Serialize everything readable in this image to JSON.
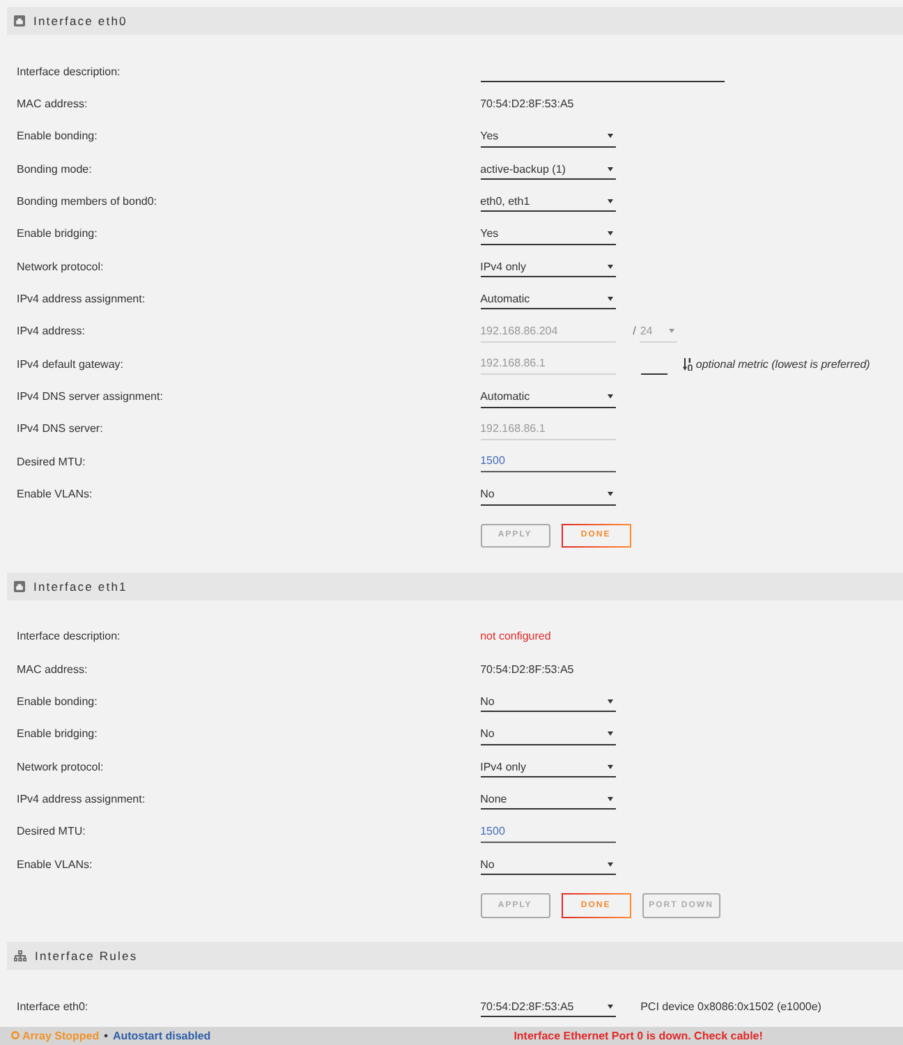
{
  "sections": [
    {
      "kind": "interface",
      "title": "Interface eth0",
      "rows": [
        {
          "label": "Interface description:",
          "controls": [
            {
              "kind": "widefield",
              "disabled": false
            }
          ]
        },
        {
          "label": "MAC address:",
          "controls": [
            {
              "kind": "text",
              "value": "70:54:D2:8F:53:A5",
              "alert": false
            }
          ]
        },
        {
          "label": "Enable bonding:",
          "controls": [
            {
              "kind": "select",
              "value": "Yes",
              "disabled": false
            }
          ]
        },
        {
          "label": "Bonding mode:",
          "controls": [
            {
              "kind": "select",
              "value": "active-backup (1)",
              "disabled": false
            }
          ]
        },
        {
          "label": "Bonding members of bond0:",
          "controls": [
            {
              "kind": "select",
              "value": "eth0, eth1",
              "disabled": false
            }
          ]
        },
        {
          "label": "Enable bridging:",
          "controls": [
            {
              "kind": "select",
              "value": "Yes",
              "disabled": false
            }
          ]
        },
        {
          "label": "Network protocol:",
          "controls": [
            {
              "kind": "select",
              "value": "IPv4 only",
              "disabled": false
            }
          ]
        },
        {
          "label": "IPv4 address assignment:",
          "controls": [
            {
              "kind": "select",
              "value": "Automatic",
              "disabled": false
            }
          ]
        },
        {
          "label": "IPv4 address:",
          "controls": [
            {
              "kind": "field",
              "value": "192.168.86.204",
              "disabled": true
            },
            {
              "kind": "separator",
              "text": "/"
            },
            {
              "kind": "miniselect",
              "value": "24",
              "disabled": true
            }
          ]
        },
        {
          "label": "IPv4 default gateway:",
          "controls": [
            {
              "kind": "field",
              "value": "192.168.86.1",
              "disabled": true
            },
            {
              "kind": "shortfield",
              "disabled": false
            },
            {
              "kind": "hint",
              "text": "optional metric (lowest is preferred)"
            }
          ]
        },
        {
          "label": "IPv4 DNS server assignment:",
          "controls": [
            {
              "kind": "select",
              "value": "Automatic",
              "disabled": false
            }
          ]
        },
        {
          "label": "IPv4 DNS server:",
          "controls": [
            {
              "kind": "field",
              "value": "192.168.86.1",
              "disabled": true
            }
          ]
        },
        {
          "label": "Desired MTU:",
          "controls": [
            {
              "kind": "field",
              "value": "1500",
              "disabled": false
            }
          ]
        },
        {
          "label": "Enable VLANs:",
          "controls": [
            {
              "kind": "select",
              "value": "No",
              "disabled": false
            }
          ]
        }
      ],
      "buttons": [
        {
          "label": "APPLY",
          "disabled": true
        },
        {
          "label": "DONE",
          "disabled": false
        }
      ]
    },
    {
      "kind": "interface",
      "title": "Interface eth1",
      "rows": [
        {
          "label": "Interface description:",
          "controls": [
            {
              "kind": "text",
              "value": "not configured",
              "alert": true
            }
          ]
        },
        {
          "label": "MAC address:",
          "controls": [
            {
              "kind": "text",
              "value": "70:54:D2:8F:53:A5",
              "alert": false
            }
          ]
        },
        {
          "label": "Enable bonding:",
          "controls": [
            {
              "kind": "select",
              "value": "No",
              "disabled": false
            }
          ]
        },
        {
          "label": "Enable bridging:",
          "controls": [
            {
              "kind": "select",
              "value": "No",
              "disabled": false
            }
          ]
        },
        {
          "label": "Network protocol:",
          "controls": [
            {
              "kind": "select",
              "value": "IPv4 only",
              "disabled": false
            }
          ]
        },
        {
          "label": "IPv4 address assignment:",
          "controls": [
            {
              "kind": "select",
              "value": "None",
              "disabled": false
            }
          ]
        },
        {
          "label": "Desired MTU:",
          "controls": [
            {
              "kind": "field",
              "value": "1500",
              "disabled": false
            }
          ]
        },
        {
          "label": "Enable VLANs:",
          "controls": [
            {
              "kind": "select",
              "value": "No",
              "disabled": false
            }
          ]
        }
      ],
      "buttons": [
        {
          "label": "APPLY",
          "disabled": true
        },
        {
          "label": "DONE",
          "disabled": false
        },
        {
          "label": "PORT DOWN",
          "disabled": true
        }
      ]
    },
    {
      "kind": "rules",
      "title": "Interface Rules",
      "rows": [
        {
          "label": "Interface eth0:",
          "controls": [
            {
              "kind": "select",
              "value": "70:54:D2:8F:53:A5",
              "disabled": false
            },
            {
              "kind": "note",
              "text": "PCI device 0x8086:0x1502 (e1000e)"
            }
          ]
        }
      ]
    }
  ],
  "status_bar": {
    "array": {
      "text": "Array Stopped",
      "started": false
    },
    "separator": "•",
    "autostart": "Autostart disabled",
    "message": "Interface Ethernet Port 0 is down. Check cable!"
  }
}
